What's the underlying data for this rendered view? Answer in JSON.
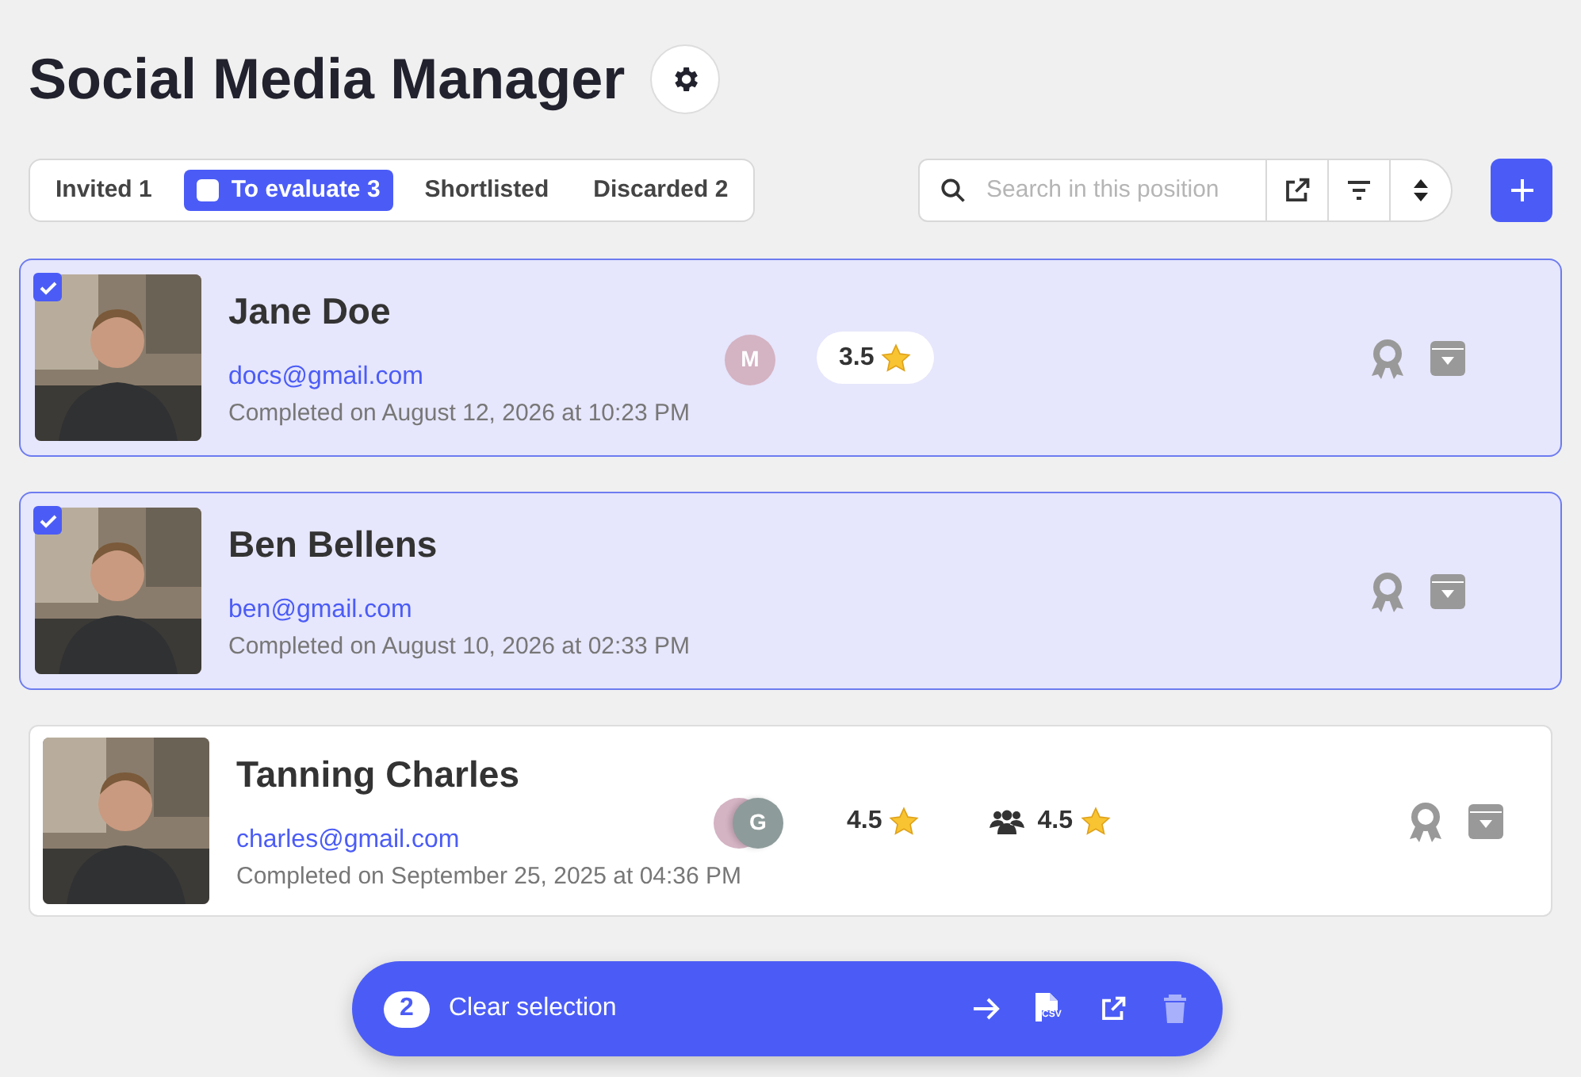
{
  "title": "Social Media Manager",
  "tabs": [
    {
      "label": "Invited 1",
      "selected": false
    },
    {
      "label": "To evaluate 3",
      "selected": true
    },
    {
      "label": "Shortlisted",
      "selected": false
    },
    {
      "label": "Discarded 2",
      "selected": false
    }
  ],
  "search": {
    "placeholder": "Search in this position"
  },
  "candidates": [
    {
      "name": "Jane Doe",
      "email": "docs@gmail.com",
      "completed": "Completed on August 12, 2026 at 10:23 PM",
      "selected": true,
      "evaluators": [
        {
          "initial": "M",
          "color": "#d4b3c3"
        }
      ],
      "rating": "3.5"
    },
    {
      "name": "Ben Bellens",
      "email": "ben@gmail.com",
      "completed": "Completed on August 10, 2026 at 02:33 PM",
      "selected": true
    },
    {
      "name": "Tanning Charles",
      "email": "charles@gmail.com",
      "completed": "Completed on September 25, 2025 at 04:36 PM",
      "selected": false,
      "evaluators": [
        {
          "color": "#d4b3c3"
        },
        {
          "initial": "G",
          "color": "#8e9b9b"
        }
      ],
      "rating": "4.5",
      "team_rating": "4.5"
    }
  ],
  "selection_bar": {
    "count": "2",
    "label": "Clear selection",
    "csv_label": "CSV"
  }
}
